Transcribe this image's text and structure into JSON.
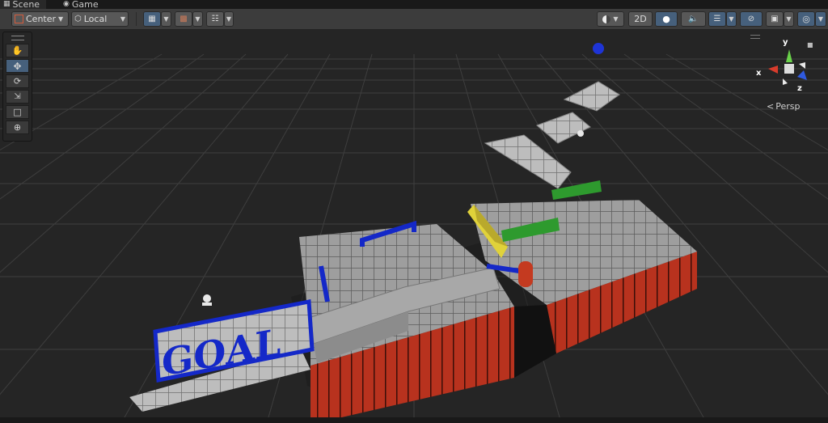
{
  "tabs": [
    {
      "label": "Scene",
      "icon": "grid-icon",
      "active": true
    },
    {
      "label": "Game",
      "icon": "gamepad-icon",
      "active": false
    }
  ],
  "toolbar": {
    "pivot_label": "Center",
    "space_label": "Local",
    "mode_2d_label": "2D"
  },
  "gizmo": {
    "y_label": "y",
    "x_label": "x",
    "z_label": "z",
    "projection_label": "Persp",
    "projection_prefix": "<"
  },
  "scene": {
    "goal_text": "GOAL",
    "colors": {
      "background": "#252525",
      "floor_tile": "#9c9c9c",
      "wall_red": "#b8321e",
      "rail_blue": "#1428c8",
      "bar_green": "#2e9a2e",
      "ramp_yellow": "#e0d23a",
      "selection": "#46607c"
    }
  }
}
